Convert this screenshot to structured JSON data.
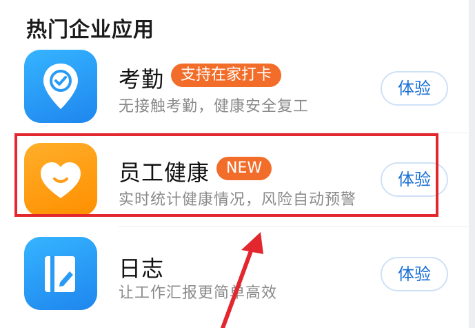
{
  "section_title": "热门企业应用",
  "apps": [
    {
      "name": "考勤",
      "badge": "支持在家打卡",
      "description": "无接触考勤，健康安全复工",
      "button": "体验",
      "icon": "location-check-icon",
      "icon_color": "#2a9bf5",
      "badge_color": "#f26d2a"
    },
    {
      "name": "员工健康",
      "badge": "NEW",
      "description": "实时统计健康情况，风险自动预警",
      "button": "体验",
      "icon": "heart-smile-icon",
      "icon_color": "#ff9b14",
      "badge_color": "#f26d2a"
    },
    {
      "name": "日志",
      "badge": "",
      "description": "让工作汇报更简单高效",
      "button": "体验",
      "icon": "journal-edit-icon",
      "icon_color": "#2a9bf5"
    }
  ],
  "annotation": {
    "highlight_color": "#e3272e",
    "arrow_color": "#e3272e"
  }
}
